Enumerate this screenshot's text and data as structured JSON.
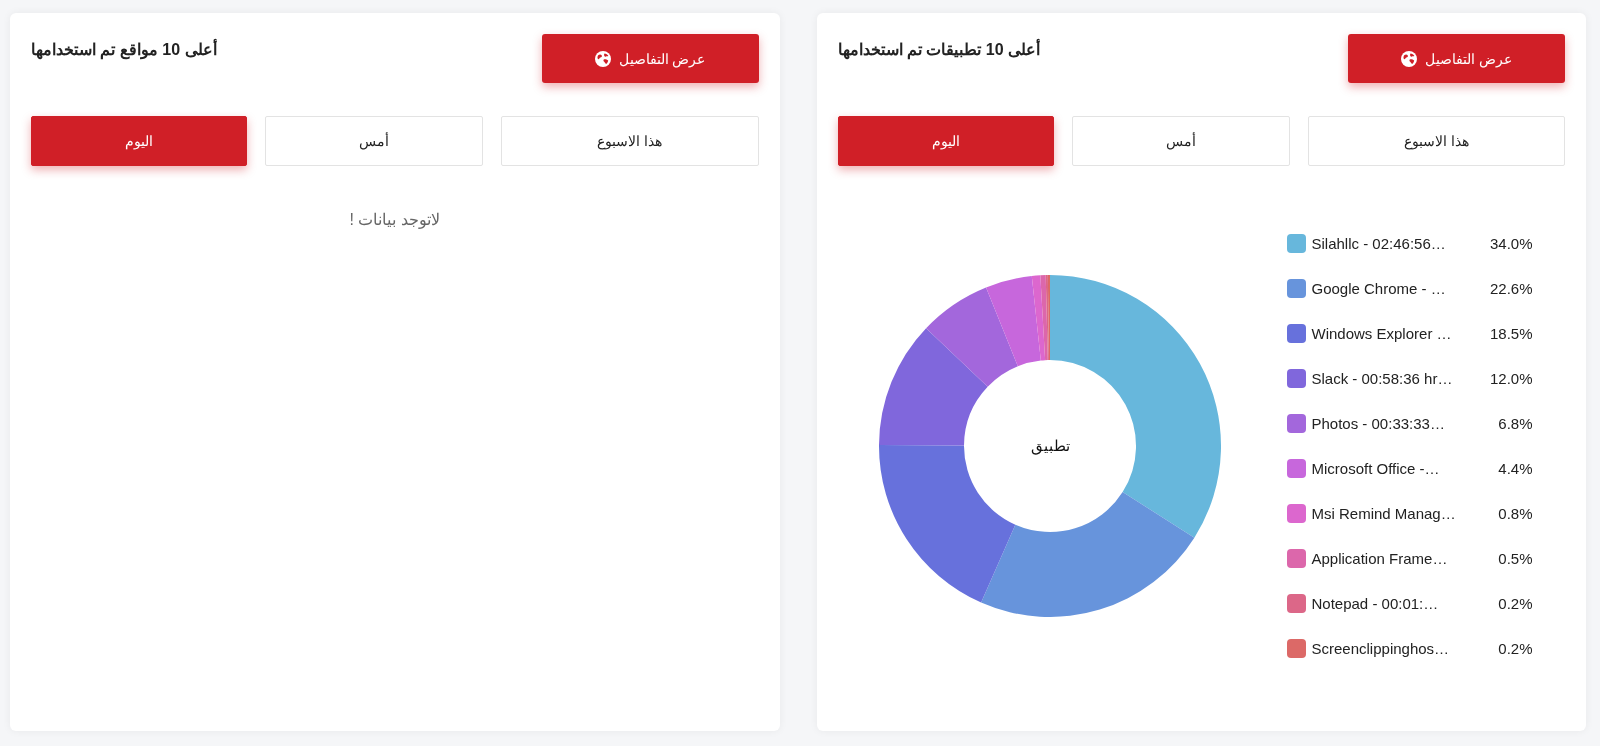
{
  "panels": [
    {
      "kind": "chart",
      "details_button": "عرض التفاصيل",
      "title": "أعلى 10 تطبيقات تم استخدامها",
      "tabs": [
        {
          "label": "هذا الاسبوع",
          "selected": false
        },
        {
          "label": "أمس",
          "selected": false
        },
        {
          "label": "اليوم",
          "selected": true
        }
      ],
      "center_label": "تطبيق",
      "chart_data": {
        "type": "donut",
        "values": [
          34.0,
          22.6,
          18.5,
          12.0,
          6.8,
          4.4,
          0.8,
          0.5,
          0.2,
          0.2
        ]
      },
      "legend": [
        {
          "label": "Silahllc - 02:46:56…",
          "percent": "34.0%",
          "color": "#67b7dc"
        },
        {
          "label": "Google Chrome - …",
          "percent": "22.6%",
          "color": "#6794dc"
        },
        {
          "label": "Windows Explorer …",
          "percent": "18.5%",
          "color": "#6771dc"
        },
        {
          "label": "Slack - 00:58:36 hr…",
          "percent": "12.0%",
          "color": "#8067dc"
        },
        {
          "label": "Photos - 00:33:33…",
          "percent": "6.8%",
          "color": "#a367dc"
        },
        {
          "label": "Microsoft Office -…",
          "percent": "4.4%",
          "color": "#c767dc"
        },
        {
          "label": "Msi Remind Manag…",
          "percent": "0.8%",
          "color": "#dc67ce"
        },
        {
          "label": "Application Frame…",
          "percent": "0.5%",
          "color": "#dc67ab"
        },
        {
          "label": "Notepad - 00:01:…",
          "percent": "0.2%",
          "color": "#dc6788"
        },
        {
          "label": "Screenclippinghos…",
          "percent": "0.2%",
          "color": "#dc6967"
        }
      ]
    },
    {
      "kind": "empty",
      "details_button": "عرض التفاصيل",
      "title": "أعلى 10 مواقع تم استخدامها",
      "tabs": [
        {
          "label": "هذا الاسبوع",
          "selected": false
        },
        {
          "label": "أمس",
          "selected": false
        },
        {
          "label": "اليوم",
          "selected": true
        }
      ],
      "empty_message": "لاتوجد بيانات !"
    }
  ]
}
